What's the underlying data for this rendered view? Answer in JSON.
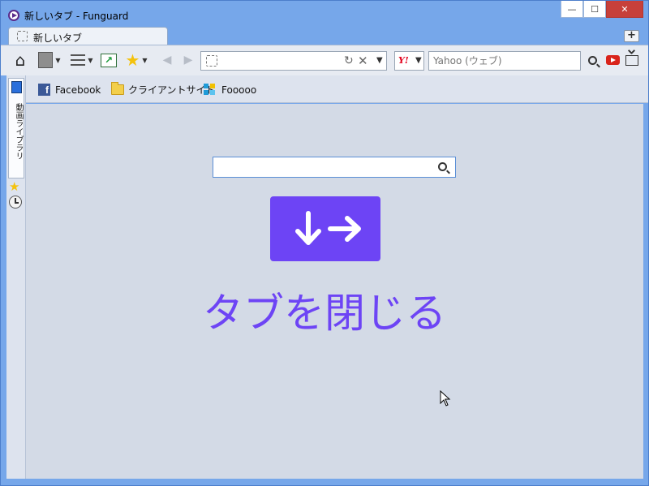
{
  "window": {
    "title": "新しいタブ - Funguard",
    "minimize": "—",
    "maximize": "☐",
    "close": "✕"
  },
  "tab": {
    "label": "新しいタブ"
  },
  "newtab": {
    "label": "+"
  },
  "toolbar": {
    "url": "",
    "search_engine": "Y!",
    "search_placeholder": "Yahoo (ウェブ)"
  },
  "bookmarks": [
    {
      "label": "Facebook",
      "icon": "facebook-icon"
    },
    {
      "label": "クライアントサイド",
      "icon": "folder-icon"
    },
    {
      "label": "Fooooo",
      "icon": "fooooo-icon"
    }
  ],
  "sidepanel": {
    "video_label": "動画ライブラリ"
  },
  "main": {
    "search_value": "",
    "close_tab_label": "タブを閉じる"
  },
  "colors": {
    "accent": "#6d44f5",
    "titlebar": "#76a7ea",
    "content_bg": "#d3dae6"
  }
}
